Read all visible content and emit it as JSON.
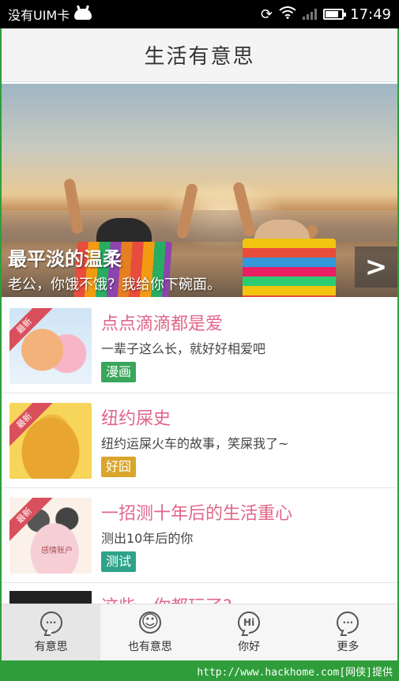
{
  "status_bar": {
    "carrier": "没有UIM卡",
    "time": "17:49",
    "icons": [
      "blackberry-icon",
      "sync-icon",
      "wifi-icon",
      "signal-icon",
      "battery-icon"
    ]
  },
  "header": {
    "title": "生活有意思"
  },
  "banner": {
    "title": "最平淡的温柔",
    "subtitle": "老公，你饿不饿？我给你下碗面。",
    "next_label": ">"
  },
  "items": [
    {
      "title": "点点滴滴都是爱",
      "desc": "一辈子这么长，就好好相爱吧",
      "tag": "漫画",
      "tag_color": "#3aa65b",
      "badge": "最新"
    },
    {
      "title": "纽约屎史",
      "desc": "纽约运屎火车的故事，笑屎我了~",
      "tag": "好囧",
      "tag_color": "#d9a52b",
      "badge": "最新"
    },
    {
      "title": "一招测十年后的生活重心",
      "desc": "测出10年后的你",
      "tag": "测试",
      "tag_color": "#2ea38a",
      "badge": "最新",
      "thumb_text": "感情账户"
    },
    {
      "title": "这些一你都玩了?"
    }
  ],
  "bottom_nav": [
    {
      "label": "有意思",
      "icon": "chat-dots-icon",
      "glyph": "···",
      "active": true
    },
    {
      "label": "也有意思",
      "icon": "smiley-icon",
      "glyph": "☺",
      "active": false
    },
    {
      "label": "你好",
      "icon": "hi-icon",
      "glyph": "Hi",
      "active": false
    },
    {
      "label": "更多",
      "icon": "more-dots-icon",
      "glyph": "···",
      "active": false
    }
  ],
  "watermark": "http://www.hackhome.com[网侠]提供",
  "colors": {
    "accent_pink": "#e0668a",
    "frame_green": "#2f9e3a",
    "ribbon_red": "#d94f5c"
  }
}
